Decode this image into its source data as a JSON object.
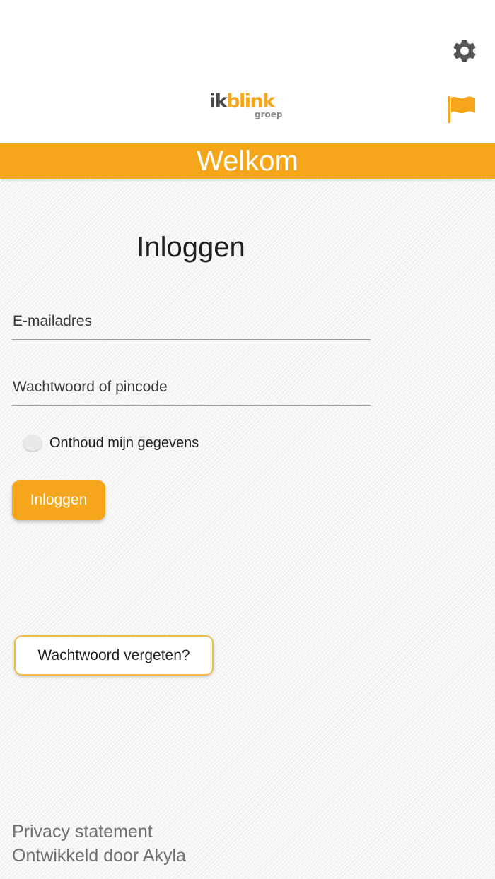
{
  "header": {
    "logo": {
      "main_dark": "ik",
      "main_accent": "blink",
      "sub": "groep"
    },
    "settings_icon": "gear-icon",
    "language_icon": "flag-icon"
  },
  "banner": {
    "title": "Welkom"
  },
  "login": {
    "title": "Inloggen",
    "email": {
      "placeholder": "E-mailadres",
      "value": ""
    },
    "password": {
      "placeholder": "Wachtwoord of pincode",
      "value": ""
    },
    "remember": {
      "label": "Onthoud mijn gegevens",
      "checked": false
    },
    "submit_label": "Inloggen",
    "forgot_label": "Wachtwoord vergeten?"
  },
  "footer": {
    "privacy": "Privacy statement",
    "credit": "Ontwikkeld door Akyla"
  },
  "colors": {
    "accent": "#f5a61a",
    "icon_gray": "#555555",
    "text": "#1f1f1f",
    "footer_text": "#6f6f6f"
  }
}
